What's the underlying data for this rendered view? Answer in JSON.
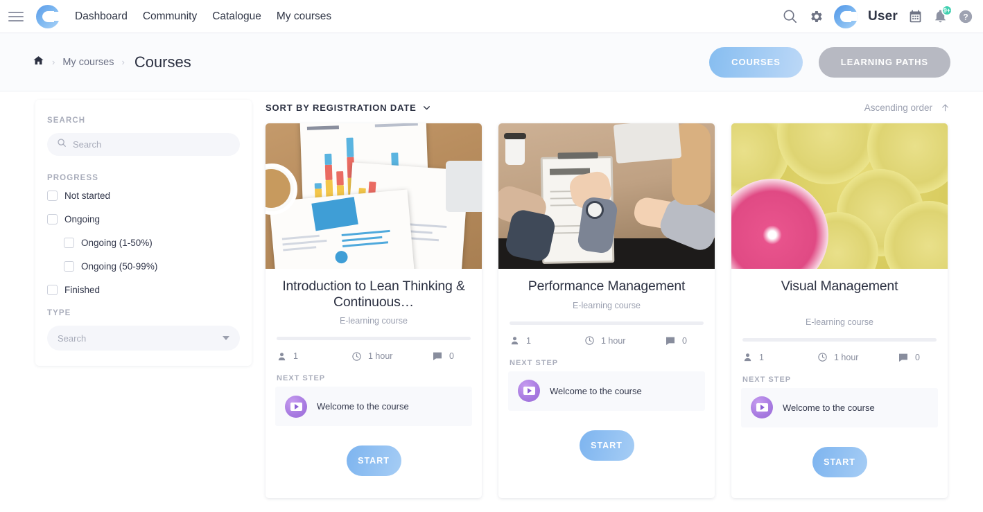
{
  "topnav": {
    "menu_icon": "hamburger-icon",
    "logo_icon": "brand-logo-icon",
    "links": [
      {
        "label": "Dashboard"
      },
      {
        "label": "Community"
      },
      {
        "label": "Catalogue"
      },
      {
        "label": "My courses"
      }
    ],
    "search_icon": "search-icon",
    "settings_icon": "gear-icon",
    "avatar_icon": "user-avatar-icon",
    "username": "User",
    "calendar_icon": "calendar-icon",
    "bell_icon": "bell-icon",
    "notification_count": "9+",
    "help_icon": "help-icon",
    "badge_color": "#3fd0b0"
  },
  "breadcrumb": {
    "home_icon": "home-icon",
    "separator": "›",
    "items": [
      {
        "label": "My courses"
      }
    ],
    "current": "Courses",
    "buttons": [
      {
        "label": "COURSES",
        "state": "active",
        "color": "#86bdf0"
      },
      {
        "label": "LEARNING PATHS",
        "state": "inactive",
        "color": "#b7b9c2"
      }
    ]
  },
  "sidebar": {
    "search_section_label": "SEARCH",
    "search_icon": "search-icon",
    "search_placeholder": "Search",
    "search_value": "",
    "progress_section_label": "PROGRESS",
    "progress_options": [
      {
        "label": "Not started",
        "checked": false,
        "indent": false
      },
      {
        "label": "Ongoing",
        "checked": false,
        "indent": false
      },
      {
        "label": "Ongoing (1-50%)",
        "checked": false,
        "indent": true
      },
      {
        "label": "Ongoing (50-99%)",
        "checked": false,
        "indent": true
      },
      {
        "label": "Finished",
        "checked": false,
        "indent": false
      }
    ],
    "type_section_label": "TYPE",
    "type_placeholder": "Search",
    "type_value": "",
    "type_caret_icon": "chevron-down-icon"
  },
  "main": {
    "sort_label": "SORT BY REGISTRATION DATE",
    "sort_caret_icon": "chevron-down-icon",
    "order_label": "Ascending order",
    "order_arrow_icon": "arrow-up-icon",
    "cards": [
      {
        "title": "Introduction to Lean Thinking & Continuous…",
        "subtitle": "E-learning course",
        "image_alt": "business-documents-with-bar-charts-on-desk",
        "progress_percent": 0,
        "stats": {
          "participants_icon": "person-icon",
          "participants": "1",
          "duration_icon": "clock-icon",
          "duration": "1 hour",
          "comments_icon": "comment-icon",
          "comments": "0"
        },
        "next_step_label": "NEXT STEP",
        "next_step_icon": "video-play-icon",
        "next_step_title": "Welcome to the course",
        "start_label": "START"
      },
      {
        "title": "Performance Management",
        "subtitle": "E-learning course",
        "image_alt": "hands-signing-contract-on-clipboard",
        "progress_percent": 0,
        "stats": {
          "participants_icon": "person-icon",
          "participants": "1",
          "duration_icon": "clock-icon",
          "duration": "1 hour",
          "comments_icon": "comment-icon",
          "comments": "0"
        },
        "next_step_label": "NEXT STEP",
        "next_step_icon": "video-play-icon",
        "next_step_title": "Welcome to the course",
        "start_label": "START"
      },
      {
        "title": "Visual Management",
        "subtitle": "E-learning course",
        "image_alt": "sliced-lemons-and-pink-grapefruit",
        "progress_percent": 0,
        "stats": {
          "participants_icon": "person-icon",
          "participants": "1",
          "duration_icon": "clock-icon",
          "duration": "1 hour",
          "comments_icon": "comment-icon",
          "comments": "0"
        },
        "next_step_label": "NEXT STEP",
        "next_step_icon": "video-play-icon",
        "next_step_title": "Welcome to the course",
        "start_label": "START"
      }
    ]
  }
}
